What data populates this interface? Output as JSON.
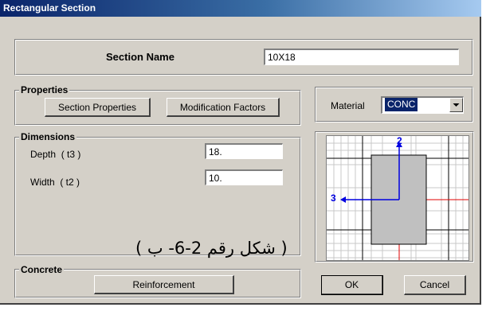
{
  "window": {
    "title": "Rectangular Section"
  },
  "section": {
    "label": "Section Name",
    "value": "10X18"
  },
  "properties": {
    "group_label": "Properties",
    "section_properties_button": "Section Properties",
    "modification_factors_button": "Modification Factors"
  },
  "material": {
    "label": "Material",
    "value": "CONC"
  },
  "dimensions": {
    "group_label": "Dimensions",
    "depth_label": "Depth  ( t3 )",
    "depth_value": "18.",
    "width_label": "Width  ( t2 )",
    "width_value": "10."
  },
  "preview": {
    "axis_vertical": "2",
    "axis_horizontal": "3"
  },
  "caption": "( شكل رقم 2-6- ب )",
  "concrete": {
    "group_label": "Concrete",
    "reinforcement_button": "Reinforcement"
  },
  "actions": {
    "ok_label": "OK",
    "cancel_label": "Cancel"
  }
}
